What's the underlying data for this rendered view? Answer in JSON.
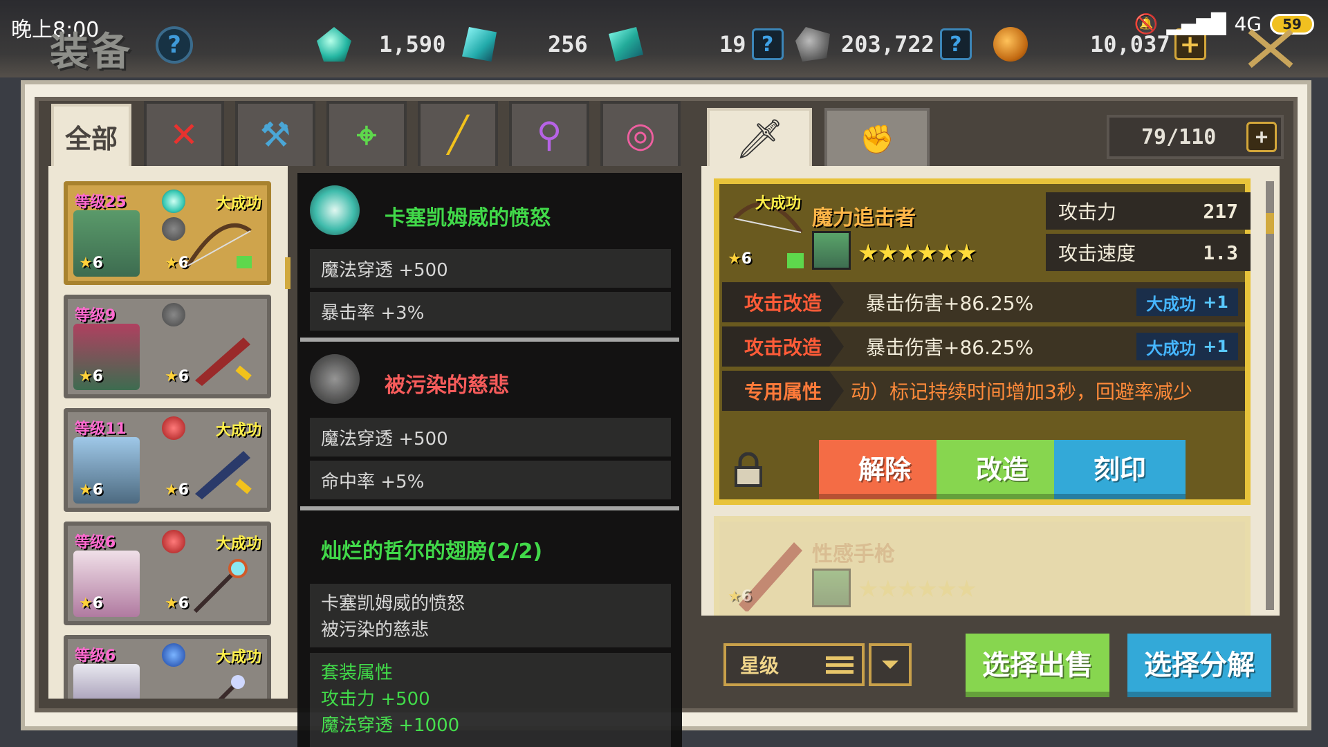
{
  "status": {
    "time": "晚上8:00",
    "network": "4G",
    "battery": "59"
  },
  "header": {
    "title": "装备",
    "help_label": "?"
  },
  "currencies": [
    {
      "icon": "green-gem-icon",
      "value": "1,590"
    },
    {
      "icon": "cyan-crystal-icon",
      "value": "256"
    },
    {
      "icon": "blue-crystal-icon",
      "value": "19"
    },
    {
      "icon": "stone-ore-icon",
      "value": "203,722"
    },
    {
      "icon": "gold-coin-icon",
      "value": "10,037"
    }
  ],
  "tabs": [
    {
      "label": "全部",
      "icon": "all"
    },
    {
      "label": "",
      "icon": "sword-icon",
      "color": "#e8322f",
      "glyph": "✕"
    },
    {
      "label": "",
      "icon": "hammer-icon",
      "color": "#4aa6d6",
      "glyph": "⚒"
    },
    {
      "label": "",
      "icon": "bow-icon",
      "color": "#5ed84c",
      "glyph": "⌖"
    },
    {
      "label": "",
      "icon": "gun-icon",
      "color": "#f2c21c",
      "glyph": "╱"
    },
    {
      "label": "",
      "icon": "staff-icon",
      "color": "#b763e6",
      "glyph": "⚲"
    },
    {
      "label": "",
      "icon": "accessory-icon",
      "color": "#ee5fa0",
      "glyph": "◎"
    }
  ],
  "hero_list": [
    {
      "level": "等级25",
      "stars_hero": "6",
      "stars_weapon": "6",
      "great": "大成功",
      "orb": "teal",
      "weapon": "bow",
      "selected": true
    },
    {
      "level": "等级9",
      "stars_hero": "6",
      "stars_weapon": "6",
      "great": "",
      "orb": "gray",
      "weapon": "gun",
      "selected": false
    },
    {
      "level": "等级11",
      "stars_hero": "6",
      "stars_weapon": "6",
      "great": "大成功",
      "orb": "red",
      "weapon": "gun",
      "selected": false
    },
    {
      "level": "等级6",
      "stars_hero": "6",
      "stars_weapon": "6",
      "great": "大成功",
      "orb": "red",
      "weapon": "staff",
      "selected": false
    },
    {
      "level": "等级6",
      "stars_hero": "6",
      "stars_weapon": "6",
      "great": "大成功",
      "orb": "blue",
      "weapon": "staff",
      "selected": false
    }
  ],
  "tooltip": {
    "gem1": {
      "name": "卡塞凯姆威的愤怒",
      "stats": [
        "魔法穿透 +500",
        "暴击率 +3%"
      ]
    },
    "gem2": {
      "name": "被污染的慈悲",
      "stats": [
        "魔法穿透 +500",
        "命中率 +5%"
      ]
    },
    "set": {
      "name": "灿烂的哲尔的翅膀(2/2)",
      "members": [
        "卡塞凯姆威的愤怒",
        "被污染的慈悲"
      ],
      "bonus_title": "套装属性",
      "bonuses": [
        "攻击力 +500",
        "魔法穿透 +1000"
      ]
    }
  },
  "right": {
    "capacity": "79/110",
    "equipped": {
      "name": "魔力追击者",
      "great": "大成功",
      "stars": "6",
      "rating": "★★★★★★",
      "stats": [
        {
          "label": "攻击力",
          "value": "217"
        },
        {
          "label": "攻击速度",
          "value": "1.3"
        }
      ],
      "mods": [
        {
          "tag": "攻击改造",
          "text": "暴击伤害+86.25%",
          "badge": "大成功",
          "badge_value": "+1"
        },
        {
          "tag": "攻击改造",
          "text": "暴击伤害+86.25%",
          "badge": "大成功",
          "badge_value": "+1"
        },
        {
          "tag": "专用属性",
          "text": "动）标记持续时间增加3秒，回避率减少"
        }
      ],
      "buttons": {
        "release": "解除",
        "modify": "改造",
        "engrave": "刻印"
      }
    },
    "next": {
      "name": "性感手枪",
      "stars": "6",
      "rating": "★★★★★★"
    }
  },
  "footer": {
    "sort_label": "星级",
    "sell_label": "选择出售",
    "dismantle_label": "选择分解"
  }
}
